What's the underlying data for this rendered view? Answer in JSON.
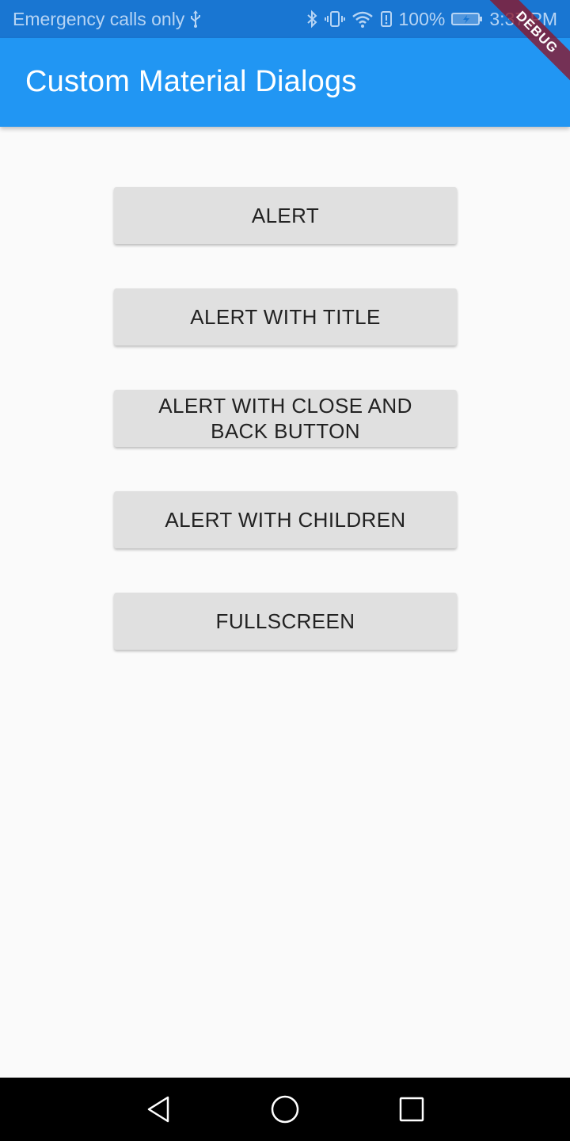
{
  "status_bar": {
    "carrier_text": "Emergency calls only",
    "battery_percent": "100%",
    "time": "3:37 PM",
    "icons": [
      "usb-icon",
      "bluetooth-icon",
      "vibrate-icon",
      "wifi-icon",
      "battery-alert-icon",
      "battery-charging-icon"
    ]
  },
  "app_bar": {
    "title": "Custom Material Dialogs",
    "color": "#2196f3"
  },
  "debug_banner": "DEBUG",
  "buttons": [
    {
      "label": "ALERT"
    },
    {
      "label": "ALERT WITH TITLE"
    },
    {
      "label": "ALERT WITH CLOSE AND BACK BUTTON"
    },
    {
      "label": "ALERT WITH CHILDREN"
    },
    {
      "label": "FULLSCREEN"
    }
  ],
  "nav_bar": {
    "icons": [
      "back-icon",
      "home-icon",
      "recents-icon"
    ]
  }
}
